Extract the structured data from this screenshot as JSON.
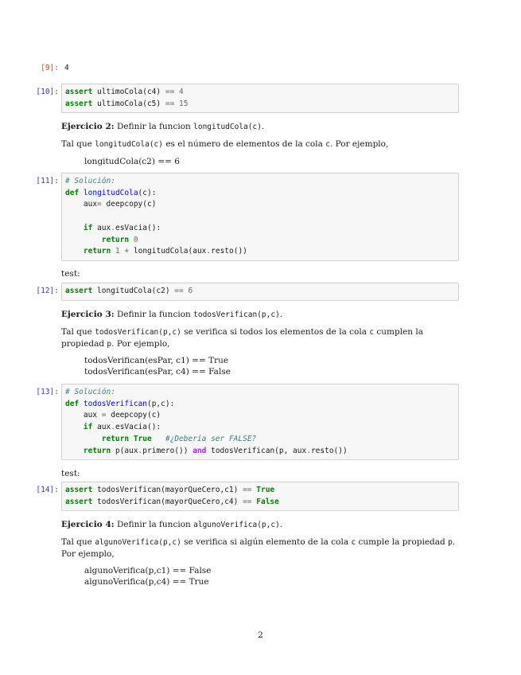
{
  "cells": {
    "out9": {
      "prompt": "[9]:",
      "value": "4"
    },
    "in10": {
      "prompt": "[10]:"
    },
    "in11": {
      "prompt": "[11]:",
      "comment": "# Solución:"
    },
    "in12": {
      "prompt": "[12]:"
    },
    "in13": {
      "prompt": "[13]:",
      "comment": "# Solución:",
      "inline_comment": "#¿Debería ser FALSE?"
    },
    "in14": {
      "prompt": "[14]:"
    }
  },
  "ej2": {
    "title": "Ejercicio 2:",
    "text": "Definir la funcion",
    "fname": "longitudCola(c)",
    "desc_pre": "Tal que",
    "desc_code": "longitudCola(c)",
    "desc_mid": "es el número de elementos de la cola",
    "desc_var": "c",
    "desc_post": ". Por ejemplo,",
    "example": "longitudCola(c2) == 6"
  },
  "test1": "test:",
  "ej3": {
    "title": "Ejercicio 3:",
    "text": "Definir la funcion",
    "fname": "todosVerifican(p,c)",
    "desc_pre": "Tal que",
    "desc_code": "todosVerifican(p,c)",
    "desc_mid": "se verifica si todos los elementos de la cola",
    "desc_var": "c",
    "desc_mid2": "cumplen la propiedad",
    "desc_var2": "p",
    "desc_post": ". Por ejemplo,",
    "example1": "todosVerifican(esPar, c1) == True",
    "example2": "todosVerifican(esPar, c4) == False"
  },
  "test2": "test:",
  "ej4": {
    "title": "Ejercicio 4:",
    "text": "Definir la funcion",
    "fname": "algunoVerifica(p,c)",
    "desc_pre": "Tal que",
    "desc_code": "algunoVerifica(p,c)",
    "desc_mid": "se verifica si algún elemento de la cola",
    "desc_var": "c",
    "desc_mid2": "cumple la propiedad",
    "desc_var2": "p",
    "desc_post": ".",
    "desc_line2": "Por ejemplo,",
    "example1": "algunoVerifica(p,c1) == False",
    "example2": "algunoVerifica(p,c4) == True"
  },
  "page_number": "2"
}
